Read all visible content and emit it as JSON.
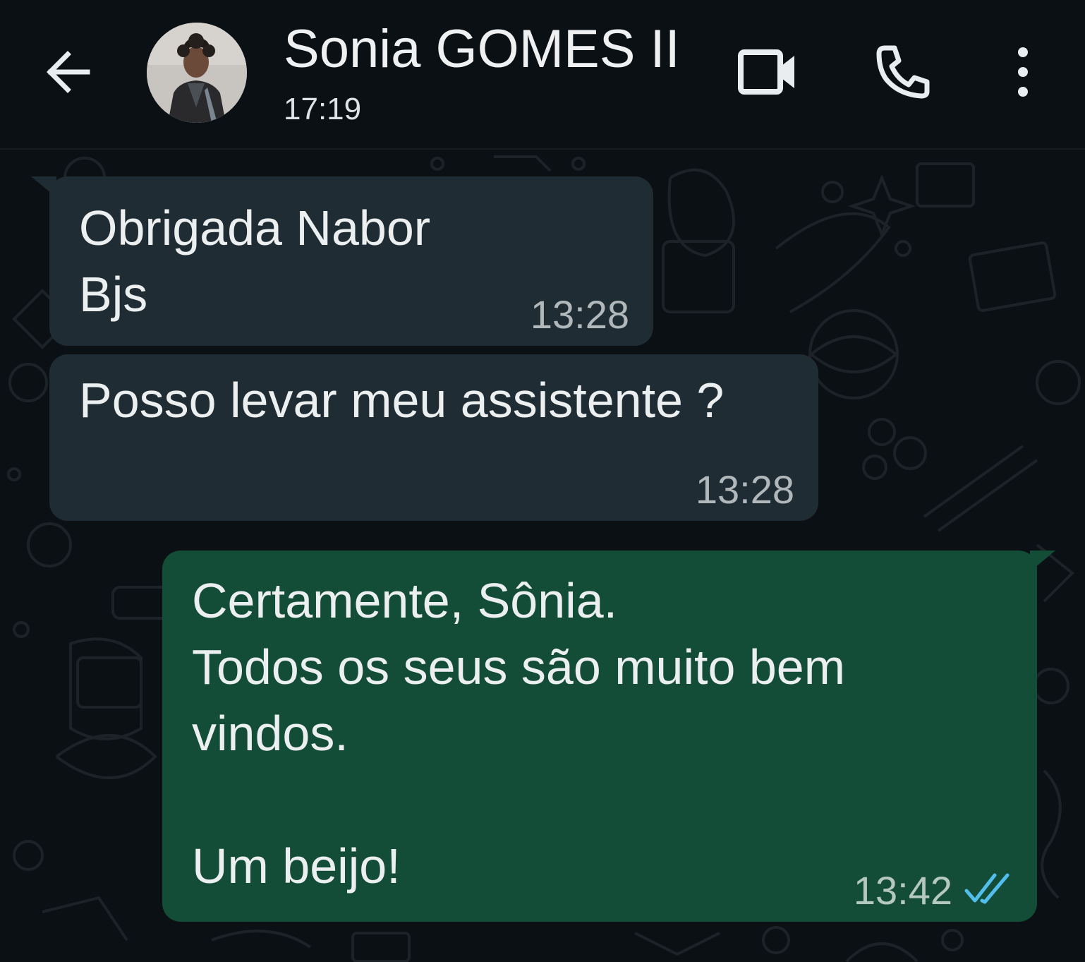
{
  "header": {
    "contact_name": "Sonia GOMES II",
    "status": "17:19",
    "back_icon": "arrow-left-icon",
    "video_icon": "video-camera-icon",
    "call_icon": "phone-icon",
    "menu_icon": "more-vertical-icon"
  },
  "messages": [
    {
      "direction": "incoming",
      "text": "Obrigada Nabor\nBjs",
      "time": "13:28"
    },
    {
      "direction": "incoming",
      "text": "Posso levar meu assistente ?",
      "time": "13:28"
    },
    {
      "direction": "outgoing",
      "text": "Certamente, Sônia.\nTodos os seus são muito bem\nvindos.\n\nUm beijo!",
      "time": "13:42",
      "status": "read",
      "status_icon": "double-check-icon"
    }
  ],
  "colors": {
    "background": "#0b1014",
    "incoming_bubble": "#202c33",
    "outgoing_bubble": "#144d37",
    "read_ticks": "#53bdeb"
  }
}
